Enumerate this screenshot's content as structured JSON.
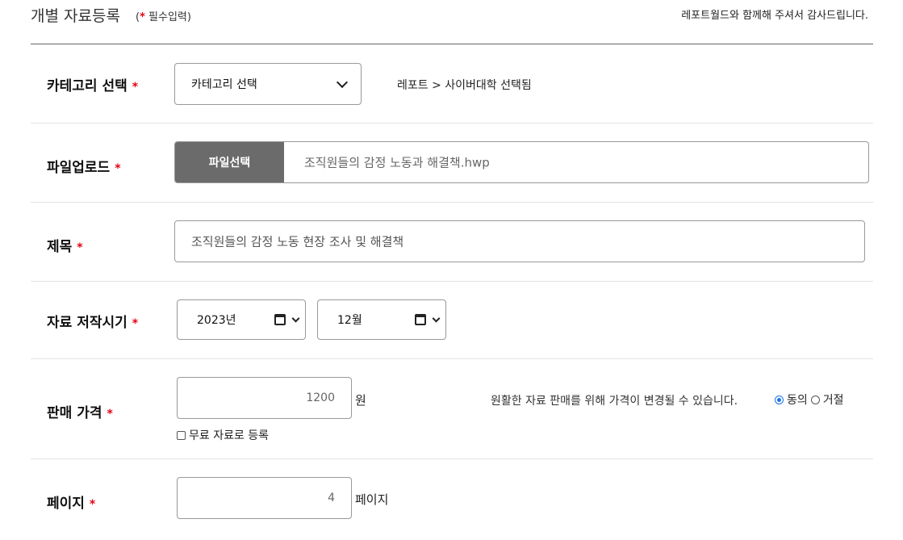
{
  "header": {
    "title": "개별 자료등록",
    "required_star": "*",
    "required_note": "필수입력",
    "thanks": "레포트월드와 함께해 주셔서 감사드립니다."
  },
  "category": {
    "label": "카테고리 선택",
    "star": "*",
    "select_value": "카테고리 선택",
    "breadcrumb": "레포트 > 사이버대학  선택됨"
  },
  "file": {
    "label": "파일업로드",
    "star": "*",
    "button_label": "파일선택",
    "file_name": "조직원들의 감정 노동과 해결책.hwp"
  },
  "title_field": {
    "label": "제목",
    "star": "*",
    "value": "조직원들의 감정 노동 현장 조사 및 해결책"
  },
  "date": {
    "label": "자료 저작시기",
    "star": "*",
    "year": "2023년",
    "month": "12월"
  },
  "price": {
    "label": "판매 가격",
    "star": "*",
    "value": "1200",
    "unit": "원",
    "notice": "원활한 자료 판매를 위해 가격이 변경될 수 있습니다.",
    "agree_label": "동의",
    "reject_label": "거절",
    "free_label": "무료 자료로 등록"
  },
  "pages": {
    "label": "페이지",
    "star": "*",
    "value": "4",
    "unit": "페이지"
  }
}
